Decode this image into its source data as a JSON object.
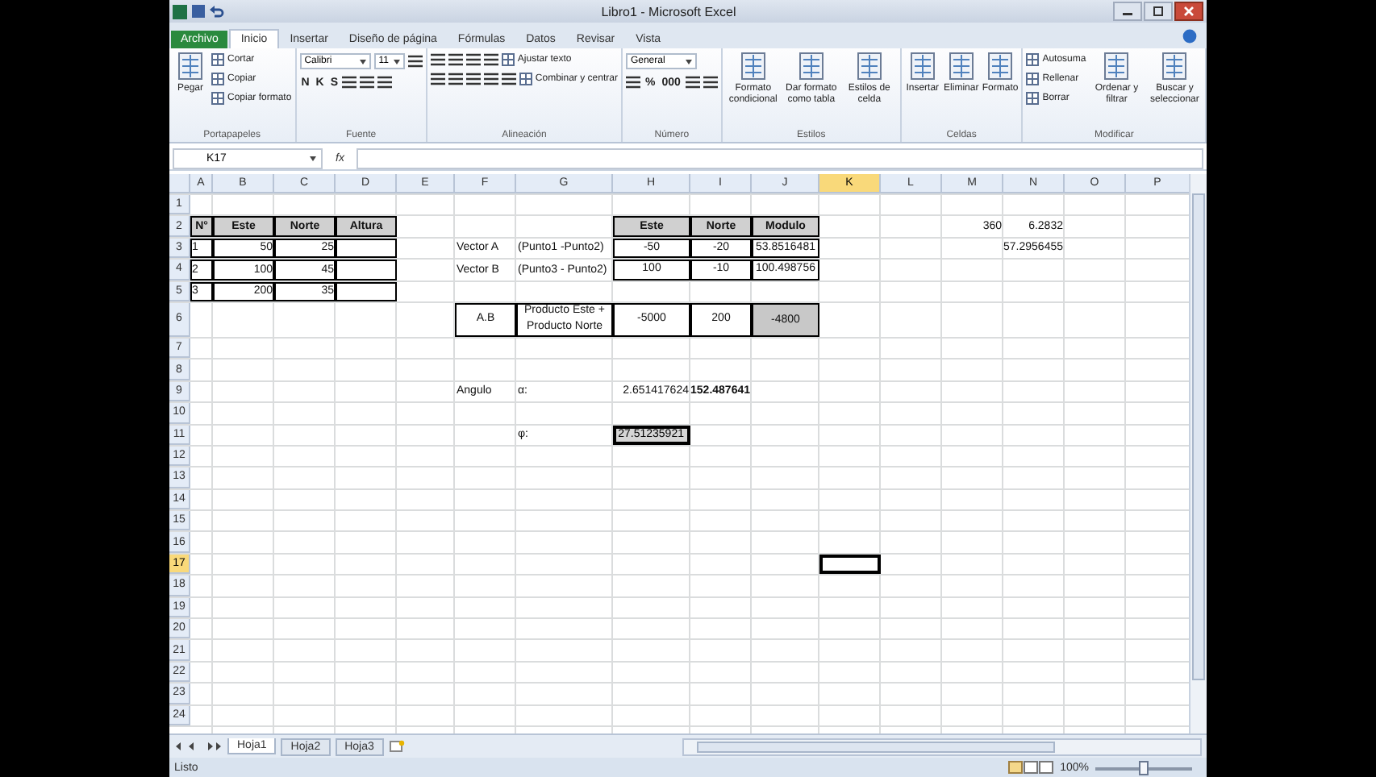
{
  "window": {
    "title": "Libro1 - Microsoft Excel"
  },
  "tabs": [
    {
      "label": "Archivo",
      "kind": "file",
      "selected": false
    },
    {
      "label": "Inicio",
      "kind": "tab",
      "selected": true
    },
    {
      "label": "Insertar",
      "kind": "tab",
      "selected": false
    },
    {
      "label": "Diseño de página",
      "kind": "tab",
      "selected": false
    },
    {
      "label": "Fórmulas",
      "kind": "tab",
      "selected": false
    },
    {
      "label": "Datos",
      "kind": "tab",
      "selected": false
    },
    {
      "label": "Revisar",
      "kind": "tab",
      "selected": false
    },
    {
      "label": "Vista",
      "kind": "tab",
      "selected": false
    }
  ],
  "ribbon": {
    "groups": [
      {
        "label": "Portapapeles",
        "parts": [
          {
            "kind": "large",
            "label": "Pegar"
          },
          {
            "kind": "stack",
            "lines": [
              {
                "items": [
                  {
                    "kind": "small",
                    "label": "Cortar"
                  }
                ]
              },
              {
                "items": [
                  {
                    "kind": "small",
                    "label": "Copiar"
                  }
                ]
              },
              {
                "items": [
                  {
                    "kind": "small",
                    "label": "Copiar formato"
                  }
                ]
              }
            ]
          }
        ]
      },
      {
        "label": "Fuente",
        "parts": [
          {
            "kind": "stack",
            "lines": [
              {
                "items": [
                  {
                    "kind": "field",
                    "label": "Calibri"
                  },
                  {
                    "kind": "field",
                    "label": "11"
                  },
                  {
                    "kind": "icon"
                  }
                ]
              },
              {
                "items": [
                  {
                    "kind": "glyph",
                    "label": "N"
                  },
                  {
                    "kind": "glyph",
                    "label": "K"
                  },
                  {
                    "kind": "glyph",
                    "label": "S"
                  },
                  {
                    "kind": "icon"
                  },
                  {
                    "kind": "icon"
                  },
                  {
                    "kind": "icon"
                  }
                ]
              }
            ]
          }
        ]
      },
      {
        "label": "Alineación",
        "parts": [
          {
            "kind": "stack",
            "lines": [
              {
                "items": [
                  {
                    "kind": "icon"
                  },
                  {
                    "kind": "icon"
                  },
                  {
                    "kind": "icon"
                  },
                  {
                    "kind": "icon"
                  },
                  {
                    "kind": "small",
                    "label": "Ajustar texto"
                  }
                ]
              },
              {
                "items": [
                  {
                    "kind": "icon"
                  },
                  {
                    "kind": "icon"
                  },
                  {
                    "kind": "icon"
                  },
                  {
                    "kind": "icon"
                  },
                  {
                    "kind": "icon"
                  },
                  {
                    "kind": "small",
                    "label": "Combinar y centrar"
                  }
                ]
              }
            ]
          }
        ]
      },
      {
        "label": "Número",
        "parts": [
          {
            "kind": "stack",
            "lines": [
              {
                "items": [
                  {
                    "kind": "field",
                    "label": "General"
                  }
                ]
              },
              {
                "items": [
                  {
                    "kind": "icon"
                  },
                  {
                    "kind": "glyph",
                    "label": "%"
                  },
                  {
                    "kind": "glyph",
                    "label": "000"
                  },
                  {
                    "kind": "icon"
                  },
                  {
                    "kind": "icon"
                  }
                ]
              }
            ]
          }
        ]
      },
      {
        "label": "Estilos",
        "parts": [
          {
            "kind": "large",
            "label": "Formato condicional"
          },
          {
            "kind": "large",
            "label": "Dar formato como tabla"
          },
          {
            "kind": "large",
            "label": "Estilos de celda"
          }
        ]
      },
      {
        "label": "Celdas",
        "parts": [
          {
            "kind": "large",
            "label": "Insertar"
          },
          {
            "kind": "large",
            "label": "Eliminar"
          },
          {
            "kind": "large",
            "label": "Formato"
          }
        ]
      },
      {
        "label": "Modificar",
        "parts": [
          {
            "kind": "stack",
            "lines": [
              {
                "items": [
                  {
                    "kind": "small",
                    "label": "Autosuma"
                  }
                ]
              },
              {
                "items": [
                  {
                    "kind": "small",
                    "label": "Rellenar"
                  }
                ]
              },
              {
                "items": [
                  {
                    "kind": "small",
                    "label": "Borrar"
                  }
                ]
              }
            ]
          },
          {
            "kind": "large",
            "label": "Ordenar y filtrar"
          },
          {
            "kind": "large",
            "label": "Buscar y seleccionar"
          }
        ]
      }
    ]
  },
  "formula_bar": {
    "name_box": "K17",
    "function_label": "fx"
  },
  "sheet": {
    "columns": [
      {
        "label": "A",
        "selected": false
      },
      {
        "label": "B",
        "selected": false
      },
      {
        "label": "C",
        "selected": false
      },
      {
        "label": "D",
        "selected": false
      },
      {
        "label": "E",
        "selected": false
      },
      {
        "label": "F",
        "selected": false
      },
      {
        "label": "G",
        "selected": false
      },
      {
        "label": "H",
        "selected": false
      },
      {
        "label": "I",
        "selected": false
      },
      {
        "label": "J",
        "selected": false
      },
      {
        "label": "K",
        "selected": true
      },
      {
        "label": "L",
        "selected": false
      },
      {
        "label": "M",
        "selected": false
      },
      {
        "label": "N",
        "selected": false
      },
      {
        "label": "O",
        "selected": false
      },
      {
        "label": "P",
        "selected": false
      }
    ],
    "rows": [
      {
        "label": "1",
        "selected": false,
        "cells": []
      },
      {
        "label": "2",
        "selected": false,
        "cells": [
          {
            "kind": "header",
            "text": "N°"
          },
          {
            "kind": "header",
            "text": "Este"
          },
          {
            "kind": "header",
            "text": "Norte"
          },
          {
            "kind": "header",
            "text": "Altura"
          },
          null,
          null,
          null,
          {
            "kind": "header",
            "text": "Este"
          },
          {
            "kind": "header",
            "text": "Norte"
          },
          {
            "kind": "header",
            "text": "Modulo"
          },
          null,
          null,
          {
            "kind": "number",
            "text": "360"
          },
          {
            "kind": "number",
            "text": "6.2832"
          }
        ]
      },
      {
        "label": "3",
        "selected": false,
        "cells": [
          {
            "kind": "box-left",
            "text": "1"
          },
          {
            "kind": "box-right",
            "text": "50"
          },
          {
            "kind": "box-right",
            "text": "25"
          },
          {
            "kind": "box-right"
          },
          null,
          {
            "kind": "text",
            "text": "Vector A"
          },
          {
            "kind": "text",
            "text": "(Punto1 -Punto2)"
          },
          {
            "kind": "box-center",
            "text": "-50"
          },
          {
            "kind": "box-center",
            "text": "-20"
          },
          {
            "kind": "box-center",
            "text": "53.8516481"
          },
          null,
          null,
          null,
          {
            "kind": "number",
            "text": "57.2956455"
          }
        ]
      },
      {
        "label": "4",
        "selected": false,
        "cells": [
          {
            "kind": "box-left",
            "text": "2"
          },
          {
            "kind": "box-right",
            "text": "100"
          },
          {
            "kind": "box-right",
            "text": "45"
          },
          {
            "kind": "box-right"
          },
          null,
          {
            "kind": "text",
            "text": "Vector B"
          },
          {
            "kind": "text",
            "text": "(Punto3 - Punto2)"
          },
          {
            "kind": "box-center",
            "text": "100"
          },
          {
            "kind": "box-center",
            "text": "-10"
          },
          {
            "kind": "box-center",
            "text": "100.498756"
          }
        ]
      },
      {
        "label": "5",
        "selected": false,
        "cells": [
          {
            "kind": "box-left",
            "text": "3"
          },
          {
            "kind": "box-right",
            "text": "200"
          },
          {
            "kind": "box-right",
            "text": "35"
          },
          {
            "kind": "box-right"
          }
        ]
      },
      {
        "label": "6",
        "selected": false,
        "cells": [
          null,
          null,
          null,
          null,
          null,
          {
            "kind": "box-center",
            "text": "A.B"
          },
          {
            "kind": "box-center",
            "text": "Producto Este + Producto Norte"
          },
          {
            "kind": "box-center",
            "text": "-5000"
          },
          {
            "kind": "box-center",
            "text": "200"
          },
          {
            "kind": "box-shaded",
            "text": "-4800"
          }
        ]
      },
      {
        "label": "7",
        "selected": false,
        "cells": []
      },
      {
        "label": "8",
        "selected": false,
        "cells": []
      },
      {
        "label": "9",
        "selected": false,
        "cells": [
          null,
          null,
          null,
          null,
          null,
          {
            "kind": "text",
            "text": "Angulo"
          },
          {
            "kind": "text",
            "text": "α:"
          },
          {
            "kind": "number",
            "text": "2.651417624"
          },
          {
            "kind": "bold-number",
            "text": "152.487641"
          }
        ]
      },
      {
        "label": "10",
        "selected": false,
        "cells": []
      },
      {
        "label": "11",
        "selected": false,
        "cells": [
          null,
          null,
          null,
          null,
          null,
          null,
          {
            "kind": "text",
            "text": "φ:"
          },
          {
            "kind": "result",
            "text": "27.51235921"
          }
        ]
      },
      {
        "label": "12",
        "selected": false,
        "cells": []
      },
      {
        "label": "13",
        "selected": false,
        "cells": []
      },
      {
        "label": "14",
        "selected": false,
        "cells": []
      },
      {
        "label": "15",
        "selected": false,
        "cells": []
      },
      {
        "label": "16",
        "selected": false,
        "cells": []
      },
      {
        "label": "17",
        "selected": true,
        "cells": []
      },
      {
        "label": "18",
        "selected": false,
        "cells": []
      },
      {
        "label": "19",
        "selected": false,
        "cells": []
      },
      {
        "label": "20",
        "selected": false,
        "cells": []
      },
      {
        "label": "21",
        "selected": false,
        "cells": []
      },
      {
        "label": "22",
        "selected": false,
        "cells": []
      },
      {
        "label": "23",
        "selected": false,
        "cells": []
      },
      {
        "label": "24",
        "selected": false,
        "cells": []
      }
    ]
  },
  "sheet_tabs": [
    {
      "label": "Hoja1",
      "selected": true
    },
    {
      "label": "Hoja2",
      "selected": false
    },
    {
      "label": "Hoja3",
      "selected": false
    }
  ],
  "status_bar": {
    "status": "Listo",
    "zoom": "100%",
    "zoom_slider": {
      "level": 0.5
    }
  }
}
